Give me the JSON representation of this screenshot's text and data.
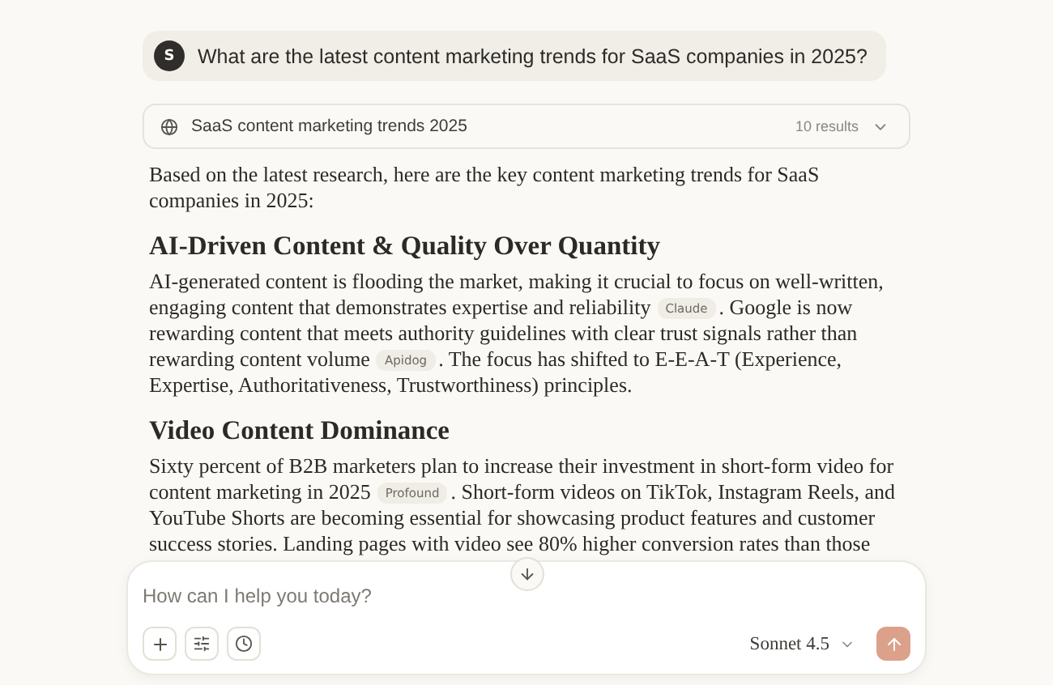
{
  "user_message": {
    "avatar": "S",
    "text": "What are the latest content marketing trends for SaaS companies in 2025?"
  },
  "search": {
    "query": "SaaS content marketing trends 2025",
    "results": "10 results",
    "expanded": false
  },
  "response": {
    "intro": "Based on the latest research, here are the key content marketing trends for SaaS companies in 2025:",
    "sections": [
      {
        "heading": "AI-Driven Content & Quality Over Quantity",
        "parts": [
          {
            "kind": "text",
            "text": "AI-generated content is flooding the market, making it crucial to focus on well-written, engaging content that demonstrates expertise and reliability"
          },
          {
            "kind": "cite",
            "text": "Claude"
          },
          {
            "kind": "text",
            "text": ". Google is now rewarding content that meets authority guidelines with clear trust signals rather than rewarding content volume"
          },
          {
            "kind": "cite",
            "text": "Apidog"
          },
          {
            "kind": "text",
            "text": ". The focus has shifted to E-E-A-T (Experience, Expertise, Authoritativeness, Trustworthiness) principles."
          }
        ]
      },
      {
        "heading": "Video Content Dominance",
        "parts": [
          {
            "kind": "text",
            "text": "Sixty percent of B2B marketers plan to increase their investment in short-form video for content marketing in 2025"
          },
          {
            "kind": "cite",
            "text": "Profound"
          },
          {
            "kind": "text",
            "text": ". Short-form videos on TikTok, Instagram Reels, and YouTube Shorts are becoming essential for showcasing product features and customer success stories. Landing pages with video see 80% higher conversion rates than those"
          }
        ]
      }
    ]
  },
  "composer": {
    "placeholder": "How can I help you today?",
    "model": "Sonnet 4.5"
  }
}
